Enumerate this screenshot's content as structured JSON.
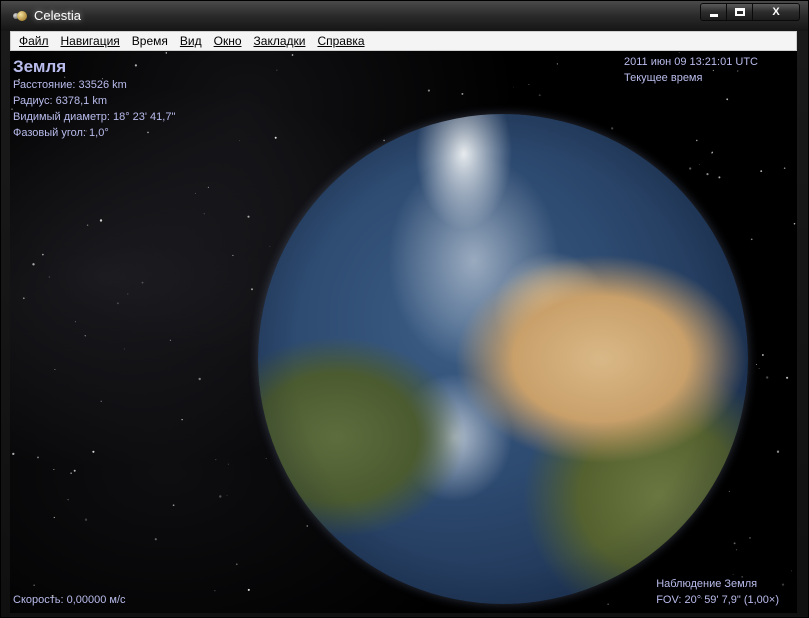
{
  "window": {
    "title": "Celestia",
    "controls": {
      "minimize": "minimize-icon",
      "maximize": "maximize-icon",
      "close": "close-icon"
    },
    "close_glyph": "X"
  },
  "menubar": {
    "items": [
      {
        "label": "Файл"
      },
      {
        "label": "Навигация"
      },
      {
        "label": "Время"
      },
      {
        "label": "Вид"
      },
      {
        "label": "Окно"
      },
      {
        "label": "Закладки"
      },
      {
        "label": "Справка"
      }
    ]
  },
  "hud": {
    "object_name": "Земля",
    "distance": "Расстояние: 33526 km",
    "radius": "Радиус: 6378,1 km",
    "apparent_diameter": "Видимый диаметр: 18° 23' 41,7\"",
    "phase_angle": "Фазовый угол: 1,0°",
    "datetime": "2011 июн 09 13:21:01 UTC",
    "time_mode": "Текущее время",
    "speed": "Скорость: 0,00000 м/с",
    "observing": "Наблюдение Земля",
    "fov": "FOV: 20° 59' 7,9\" (1,00×)"
  },
  "colors": {
    "hud_text": "#b9bcec",
    "menubar_bg": "#f4f4f4",
    "space": "#000000"
  }
}
